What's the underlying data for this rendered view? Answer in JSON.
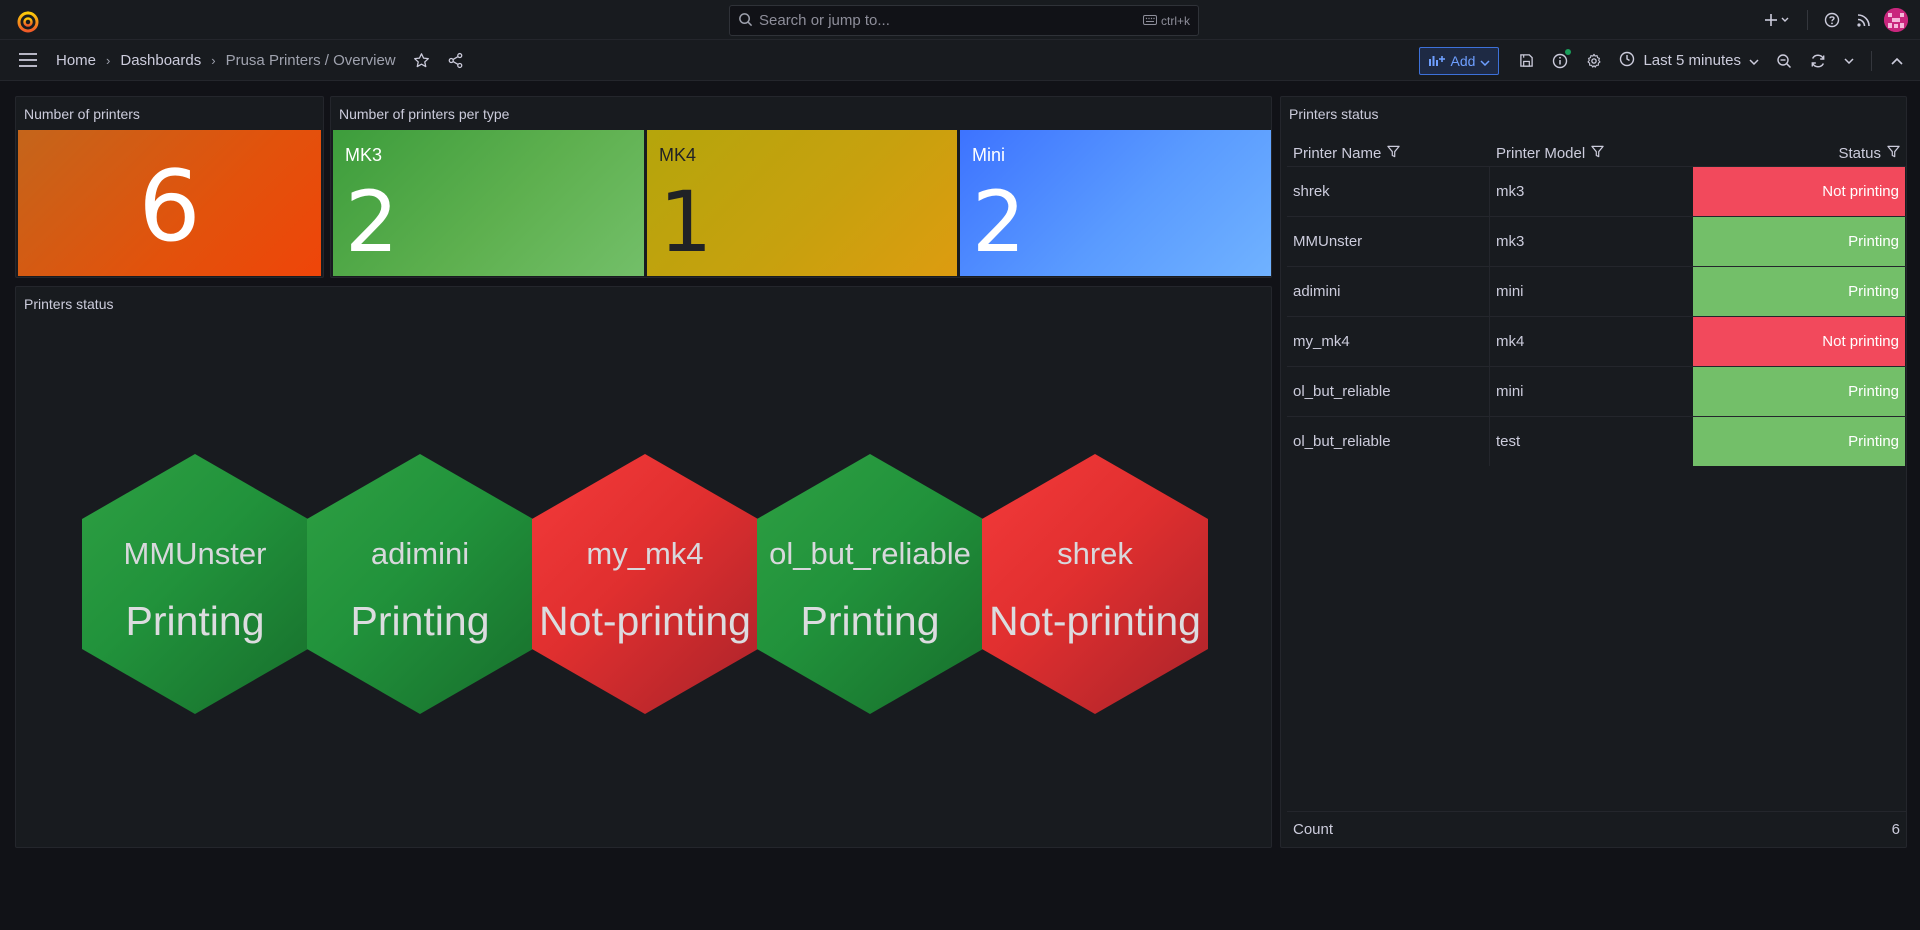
{
  "topbar": {
    "search_placeholder": "Search or jump to...",
    "shortcut": "ctrl+k"
  },
  "navbar": {
    "breadcrumbs": [
      "Home",
      "Dashboards",
      "Prusa Printers / Overview"
    ],
    "add_label": "Add",
    "time_range": "Last 5 minutes"
  },
  "panels": {
    "count_title": "Number of printers",
    "count_value": "6",
    "per_type_title": "Number of printers per type",
    "types": [
      {
        "label": "MK3",
        "value": "2",
        "color_from": "#37872d",
        "color_to": "#73bf69"
      },
      {
        "label": "MK4",
        "value": "1",
        "color_from": "#b8a70c",
        "color_to": "#e0a20f"
      },
      {
        "label": "Mini",
        "value": "2",
        "color_from": "#3d71ff",
        "color_to": "#6fb3ff"
      }
    ],
    "hex_title": "Printers status",
    "hexes": [
      {
        "name": "MMUnster",
        "status": "Printing",
        "state": "ok"
      },
      {
        "name": "adimini",
        "status": "Printing",
        "state": "ok"
      },
      {
        "name": "my_mk4",
        "status": "Not-printing",
        "state": "bad"
      },
      {
        "name": "ol_but_reliable",
        "status": "Printing",
        "state": "ok"
      },
      {
        "name": "shrek",
        "status": "Not-printing",
        "state": "bad"
      }
    ],
    "table_title": "Printers status",
    "table": {
      "columns": [
        "Printer Name",
        "Printer Model",
        "Status"
      ],
      "rows": [
        {
          "name": "shrek",
          "model": "mk3",
          "status": "Not printing",
          "state": "bad"
        },
        {
          "name": "MMUnster",
          "model": "mk3",
          "status": "Printing",
          "state": "ok"
        },
        {
          "name": "adimini",
          "model": "mini",
          "status": "Printing",
          "state": "ok"
        },
        {
          "name": "my_mk4",
          "model": "mk4",
          "status": "Not printing",
          "state": "bad"
        },
        {
          "name": "ol_but_reliable",
          "model": "mini",
          "status": "Printing",
          "state": "ok"
        },
        {
          "name": "ol_but_reliable",
          "model": "test",
          "status": "Printing",
          "state": "ok"
        }
      ],
      "footer_label": "Count",
      "footer_value": "6"
    }
  }
}
